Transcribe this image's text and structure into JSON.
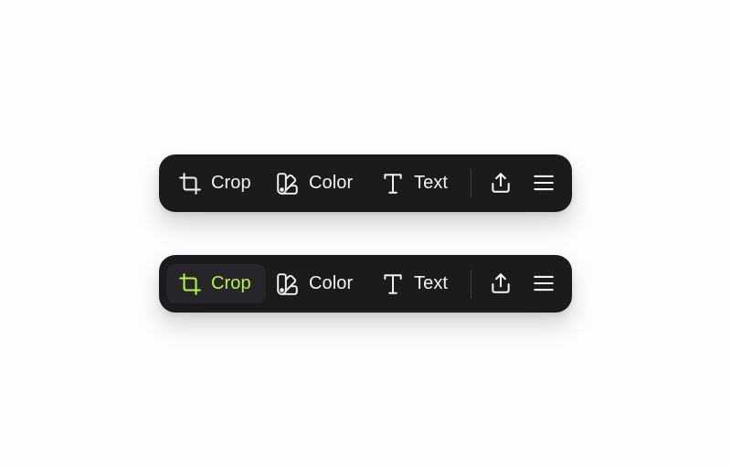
{
  "toolbars": [
    {
      "state": "default",
      "items": [
        {
          "label": "Crop",
          "icon": "crop-icon",
          "active": false
        },
        {
          "label": "Color",
          "icon": "swatch-icon",
          "active": false
        },
        {
          "label": "Text",
          "icon": "text-icon",
          "active": false
        }
      ],
      "actions": [
        {
          "icon": "share-icon"
        },
        {
          "icon": "menu-icon"
        }
      ]
    },
    {
      "state": "crop-selected",
      "items": [
        {
          "label": "Crop",
          "icon": "crop-icon",
          "active": true
        },
        {
          "label": "Color",
          "icon": "swatch-icon",
          "active": false
        },
        {
          "label": "Text",
          "icon": "text-icon",
          "active": false
        }
      ],
      "actions": [
        {
          "icon": "share-icon"
        },
        {
          "icon": "menu-icon"
        }
      ]
    }
  ],
  "colors": {
    "toolbar_bg": "#1b1a1d",
    "active_bg": "#262529",
    "accent": "#b5f73f",
    "foreground": "#f3f3f3",
    "page_bg": "#fdfdfd"
  }
}
